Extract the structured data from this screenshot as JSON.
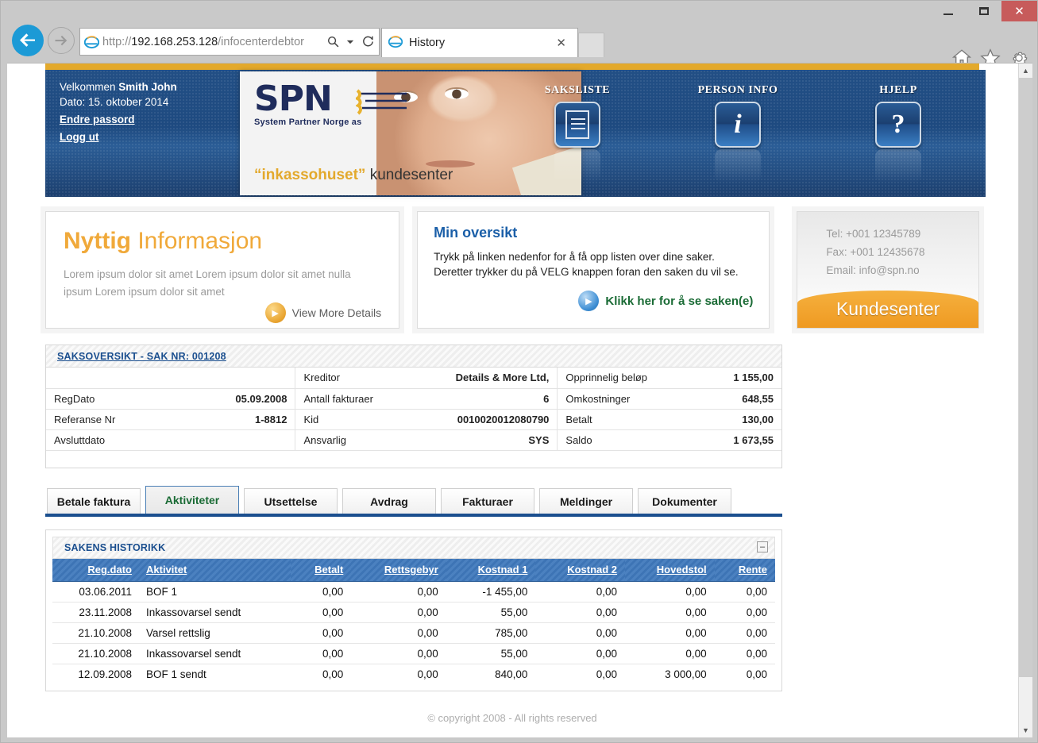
{
  "browser": {
    "window_controls": {
      "minimize": "—",
      "maximize": "▢",
      "close": "✕"
    },
    "back_label": "Back",
    "forward_label": "Forward",
    "url": "http://192.168.253.128/infocenterdebtor",
    "url_host": "192.168.253.128",
    "url_path": "/infocenterdebtor",
    "url_scheme": "http://",
    "search_icon": "search-icon",
    "refresh_icon": "refresh-icon",
    "tab": {
      "title": "History",
      "close": "✕"
    },
    "chrome_icons": [
      "home-icon",
      "favorites-star-icon",
      "settings-gear-icon"
    ]
  },
  "header": {
    "welcome_prefix": "Velkommen ",
    "user_name": "Smith John",
    "date_line": "Dato: 15. oktober 2014",
    "change_password": "Endre passord",
    "logout": "Logg ut",
    "logo_text": "SPN",
    "logo_subtitle": "System Partner Norge as",
    "tagline_quoted": "“inkassohuset”",
    "tagline_rest": " kundesenter",
    "nav": [
      {
        "label": "SAKSLISTE",
        "icon": "document-list-icon"
      },
      {
        "label": "PERSON INFO",
        "icon": "info-i-icon"
      },
      {
        "label": "HJELP",
        "icon": "question-mark-icon"
      }
    ]
  },
  "cards": {
    "info": {
      "title_bold": "Nyttig",
      "title_rest": " Informasjon",
      "body": "Lorem ipsum dolor sit amet Lorem ipsum dolor sit amet nulla ipsum Lorem ipsum dolor sit amet",
      "link_label": "View More Details"
    },
    "overview": {
      "title": "Min oversikt",
      "body_line1": "Trykk på linken nedenfor for å få opp listen over dine saker.",
      "body_line2": "Deretter trykker du på VELG knappen foran den saken du vil se.",
      "link_label": "Klikk her for å se saken(e)"
    },
    "contact": {
      "tel": "Tel: +001 12345789",
      "fax": "Fax: +001 12435678",
      "email": "Email: info@spn.no",
      "button_label": "Kundesenter"
    }
  },
  "case_overview": {
    "panel_title": "SAKSOVERSIKT - SAK NR: 001208",
    "rows": [
      {
        "c1_label": "",
        "c1_value": "",
        "c2_label": "Kreditor",
        "c2_value": "Details & More Ltd,",
        "c3_label": "Opprinnelig beløp",
        "c3_value": "1 155,00"
      },
      {
        "c1_label": "RegDato",
        "c1_value": "05.09.2008",
        "c2_label": "Antall fakturaer",
        "c2_value": "6",
        "c3_label": "Omkostninger",
        "c3_value": "648,55"
      },
      {
        "c1_label": "Referanse Nr",
        "c1_value": "1-8812",
        "c2_label": "Kid",
        "c2_value": "0010020012080790",
        "c3_label": "Betalt",
        "c3_value": "130,00"
      },
      {
        "c1_label": "Avsluttdato",
        "c1_value": "",
        "c2_label": "Ansvarlig",
        "c2_value": "SYS",
        "c3_label": "Saldo",
        "c3_value": "1 673,55"
      }
    ]
  },
  "tabs": {
    "items": [
      {
        "label": "Betale faktura",
        "active": false
      },
      {
        "label": "Aktiviteter",
        "active": true
      },
      {
        "label": "Utsettelse",
        "active": false
      },
      {
        "label": "Avdrag",
        "active": false
      },
      {
        "label": "Fakturaer",
        "active": false
      },
      {
        "label": "Meldinger",
        "active": false
      },
      {
        "label": "Dokumenter",
        "active": false
      }
    ]
  },
  "history": {
    "panel_title": "SAKENS HISTORIKK",
    "collapse_glyph": "–",
    "columns": [
      "Reg.dato",
      "Aktivitet",
      "Betalt",
      "Rettsgebyr",
      "Kostnad 1",
      "Kostnad 2",
      "Hovedstol",
      "Rente"
    ],
    "rows": [
      [
        "03.06.2011",
        "BOF 1",
        "0,00",
        "0,00",
        "-1 455,00",
        "0,00",
        "0,00",
        "0,00"
      ],
      [
        "23.11.2008",
        "Inkassovarsel sendt",
        "0,00",
        "0,00",
        "55,00",
        "0,00",
        "0,00",
        "0,00"
      ],
      [
        "21.10.2008",
        "Varsel rettslig",
        "0,00",
        "0,00",
        "785,00",
        "0,00",
        "0,00",
        "0,00"
      ],
      [
        "21.10.2008",
        "Inkassovarsel sendt",
        "0,00",
        "0,00",
        "55,00",
        "0,00",
        "0,00",
        "0,00"
      ],
      [
        "12.09.2008",
        "BOF 1 sendt",
        "0,00",
        "0,00",
        "840,00",
        "0,00",
        "3 000,00",
        "0,00"
      ]
    ]
  },
  "footer": {
    "copyright": "© copyright 2008 - All rights reserved"
  },
  "colors": {
    "brand_blue": "#1b4f8f",
    "accent_orange": "#e3a92c",
    "link_green": "#1a6b35",
    "table_header_blue": "#3d74b5",
    "close_red": "#c75b5b"
  }
}
